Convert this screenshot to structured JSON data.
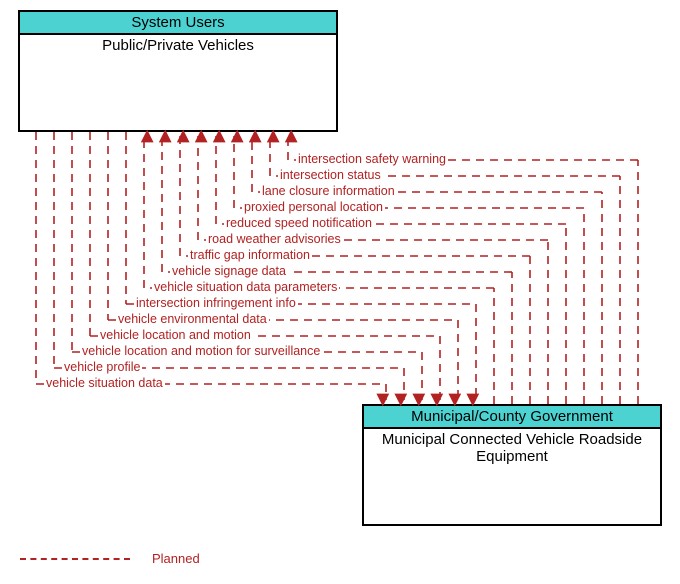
{
  "box_top": {
    "header": "System Users",
    "body": "Public/Private Vehicles"
  },
  "box_bottom": {
    "header": "Municipal/County Government",
    "body": "Municipal Connected Vehicle Roadside Equipment"
  },
  "flows_to_top": [
    "intersection safety warning",
    "intersection status",
    "lane closure information",
    "proxied personal location",
    "reduced speed notification",
    "road weather advisories",
    "traffic gap information",
    "vehicle signage data",
    "vehicle situation data parameters"
  ],
  "flows_to_bottom": [
    "intersection infringement info",
    "vehicle environmental data",
    "vehicle location and motion",
    "vehicle location and motion for surveillance",
    "vehicle profile",
    "vehicle situation data"
  ],
  "legend": {
    "planned": "Planned"
  },
  "colors": {
    "flow": "#b22222",
    "boxHeader": "#4dd2d2"
  }
}
